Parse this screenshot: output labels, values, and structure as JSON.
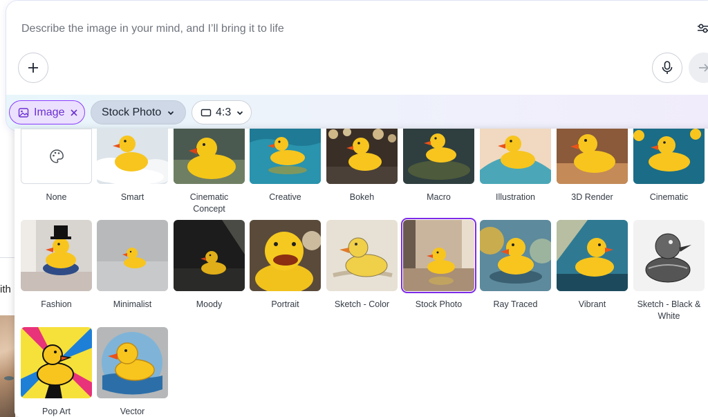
{
  "prompt": {
    "placeholder": "Describe the image in your mind, and I’ll bring it to life",
    "icons": {
      "settings": "sliders-icon",
      "add": "plus-icon",
      "mic": "microphone-icon",
      "send": "arrow-right-icon"
    }
  },
  "chips": {
    "image": {
      "label": "Image",
      "icon": "image-icon",
      "remove_icon": "close-icon"
    },
    "style": {
      "label": "Stock Photo",
      "icon": "chevron-down-icon"
    },
    "ratio": {
      "label": "4:3",
      "icon": "rectangle-icon"
    }
  },
  "background": {
    "partial_text": "ith"
  },
  "styles": [
    {
      "label": "None",
      "icon": "palette-icon"
    },
    {
      "label": "Smart"
    },
    {
      "label": "Cinematic Concept"
    },
    {
      "label": "Creative"
    },
    {
      "label": "Bokeh"
    },
    {
      "label": "Macro"
    },
    {
      "label": "Illustration"
    },
    {
      "label": "3D Render"
    },
    {
      "label": "Cinematic"
    },
    {
      "label": "Fashion"
    },
    {
      "label": "Minimalist"
    },
    {
      "label": "Moody"
    },
    {
      "label": "Portrait"
    },
    {
      "label": "Sketch - Color"
    },
    {
      "label": "Stock Photo",
      "selected": true
    },
    {
      "label": "Ray Traced"
    },
    {
      "label": "Vibrant"
    },
    {
      "label": "Sketch - Black & White"
    },
    {
      "label": "Pop Art"
    },
    {
      "label": "Vector"
    }
  ],
  "colors": {
    "accent": "#8b3dff",
    "selected_outline": "#7d2ae8",
    "duck": "#f7c51e",
    "beak": "#e8531c"
  }
}
